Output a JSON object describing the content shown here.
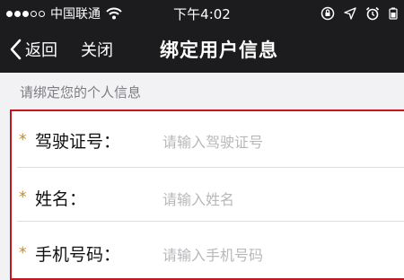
{
  "status_bar": {
    "carrier": "中国联通",
    "time": "下午4:02",
    "signal_bars_filled": 3,
    "signal_bars_total": 5,
    "icons": [
      "wifi-icon",
      "rotation-lock-icon",
      "location-arrow-icon",
      "alarm-icon",
      "battery-icon"
    ]
  },
  "nav": {
    "back_label": "返回",
    "close_label": "关闭",
    "title": "绑定用户信息"
  },
  "section": {
    "header": "请绑定您的个人信息"
  },
  "form": {
    "fields": [
      {
        "required_mark": "*",
        "label": "驾驶证号：",
        "placeholder": "请输入驾驶证号",
        "value": ""
      },
      {
        "required_mark": "*",
        "label": "姓名：",
        "placeholder": "请输入姓名",
        "value": ""
      },
      {
        "required_mark": "*",
        "label": "手机号码：",
        "placeholder": "请输入手机号码",
        "value": ""
      }
    ]
  },
  "colors": {
    "bar_background": "#1c1c1e",
    "highlight_border": "#c4161c",
    "asterisk": "#c28a1e"
  }
}
